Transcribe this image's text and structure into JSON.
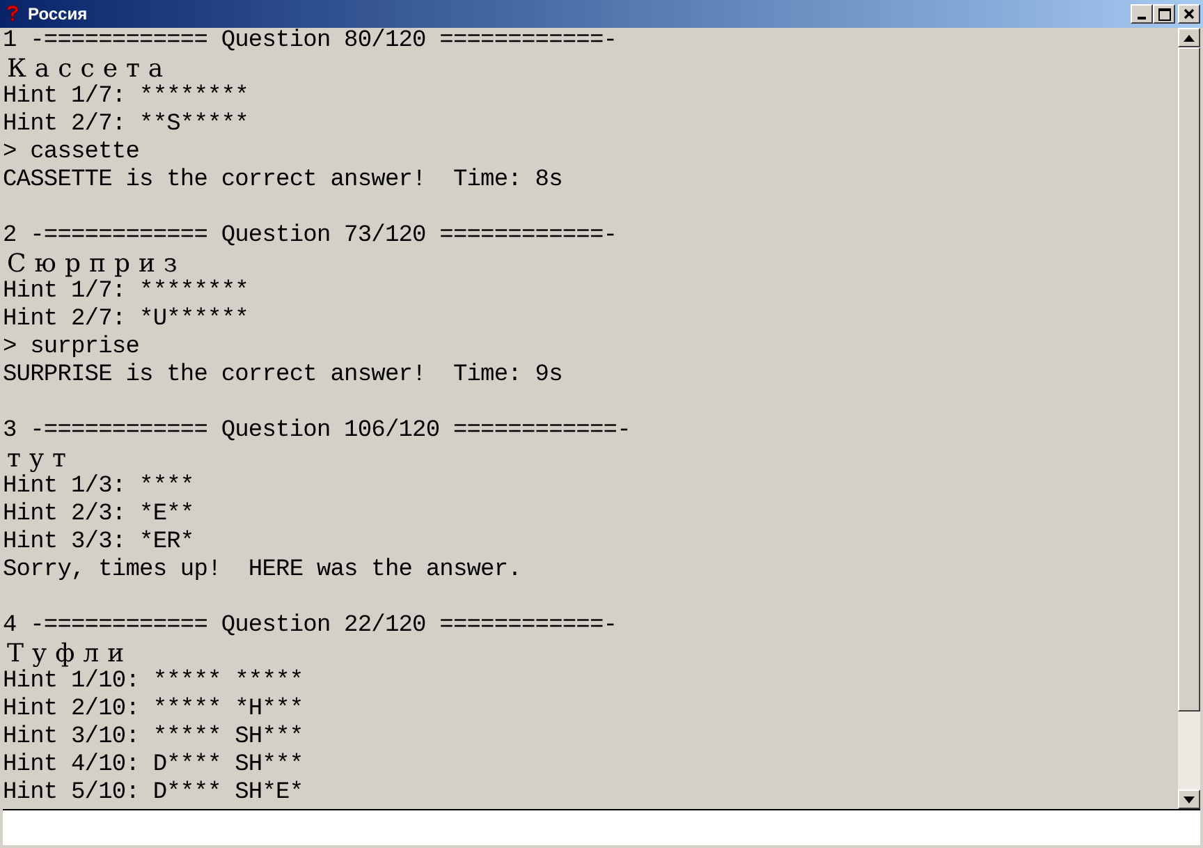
{
  "window": {
    "title": "Россия"
  },
  "questions": [
    {
      "header": "1 -============ Question 80/120 ============-",
      "word": "Кассета",
      "lines": [
        "Hint 1/7: ********",
        "Hint 2/7: **S*****",
        "> cassette",
        "CASSETTE is the correct answer!  Time: 8s"
      ]
    },
    {
      "header": "2 -============ Question 73/120 ============-",
      "word": "Сюрприз",
      "lines": [
        "Hint 1/7: ********",
        "Hint 2/7: *U******",
        "> surprise",
        "SURPRISE is the correct answer!  Time: 9s"
      ]
    },
    {
      "header": "3 -============ Question 106/120 ============-",
      "word": "тут",
      "lines": [
        "Hint 1/3: ****",
        "Hint 2/3: *E**",
        "Hint 3/3: *ER*",
        "Sorry, times up!  HERE was the answer."
      ]
    },
    {
      "header": "4 -============ Question 22/120 ============-",
      "word": "Туфли",
      "lines": [
        "Hint 1/10: ***** *****",
        "Hint 2/10: ***** *H***",
        "Hint 3/10: ***** SH***",
        "Hint 4/10: D**** SH***",
        "Hint 5/10: D**** SH*E*"
      ]
    }
  ]
}
